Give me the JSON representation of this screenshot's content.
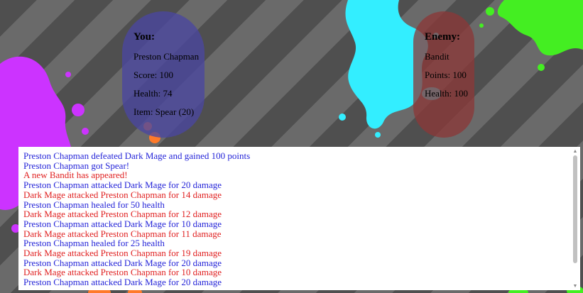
{
  "player": {
    "heading": "You:",
    "name": "Preston Chapman",
    "score": "Score: 100",
    "health": "Health: 74",
    "item": "Item: Spear (20)"
  },
  "enemy": {
    "heading": "Enemy:",
    "name": "Bandit",
    "points": "Points: 100",
    "health": "Health: 100"
  },
  "log": [
    {
      "text": "Preston Chapman defeated Dark Mage and gained 100 points",
      "kind": "player"
    },
    {
      "text": "Preston Chapman got Spear!",
      "kind": "player"
    },
    {
      "text": "A new Bandit has appeared!",
      "kind": "enemy"
    },
    {
      "text": "Preston Chapman attacked Dark Mage for 20 damage",
      "kind": "player"
    },
    {
      "text": "Dark Mage attacked Preston Chapman for 14 damage",
      "kind": "enemy"
    },
    {
      "text": "Preston Chapman healed for 50 health",
      "kind": "player"
    },
    {
      "text": "Dark Mage attacked Preston Chapman for 12 damage",
      "kind": "enemy"
    },
    {
      "text": "Preston Chapman attacked Dark Mage for 10 damage",
      "kind": "player"
    },
    {
      "text": "Dark Mage attacked Preston Chapman for 11 damage",
      "kind": "enemy"
    },
    {
      "text": "Preston Chapman healed for 25 health",
      "kind": "player"
    },
    {
      "text": "Dark Mage attacked Preston Chapman for 19 damage",
      "kind": "enemy"
    },
    {
      "text": "Preston Chapman attacked Dark Mage for 20 damage",
      "kind": "player"
    },
    {
      "text": "Dark Mage attacked Preston Chapman for 10 damage",
      "kind": "enemy"
    },
    {
      "text": "Preston Chapman attacked Dark Mage for 20 damage",
      "kind": "player"
    }
  ],
  "colors": {
    "player_text": "#2424d8",
    "enemy_text": "#e02020",
    "player_panel": "#4a46a0",
    "enemy_panel": "#8c3737",
    "splat_magenta": "#cc33ff",
    "splat_cyan": "#33eeff",
    "splat_green": "#44ee22",
    "splat_orange": "#ff7a2a"
  },
  "icons": {
    "scroll_up": "▲",
    "scroll_down": "▼"
  }
}
